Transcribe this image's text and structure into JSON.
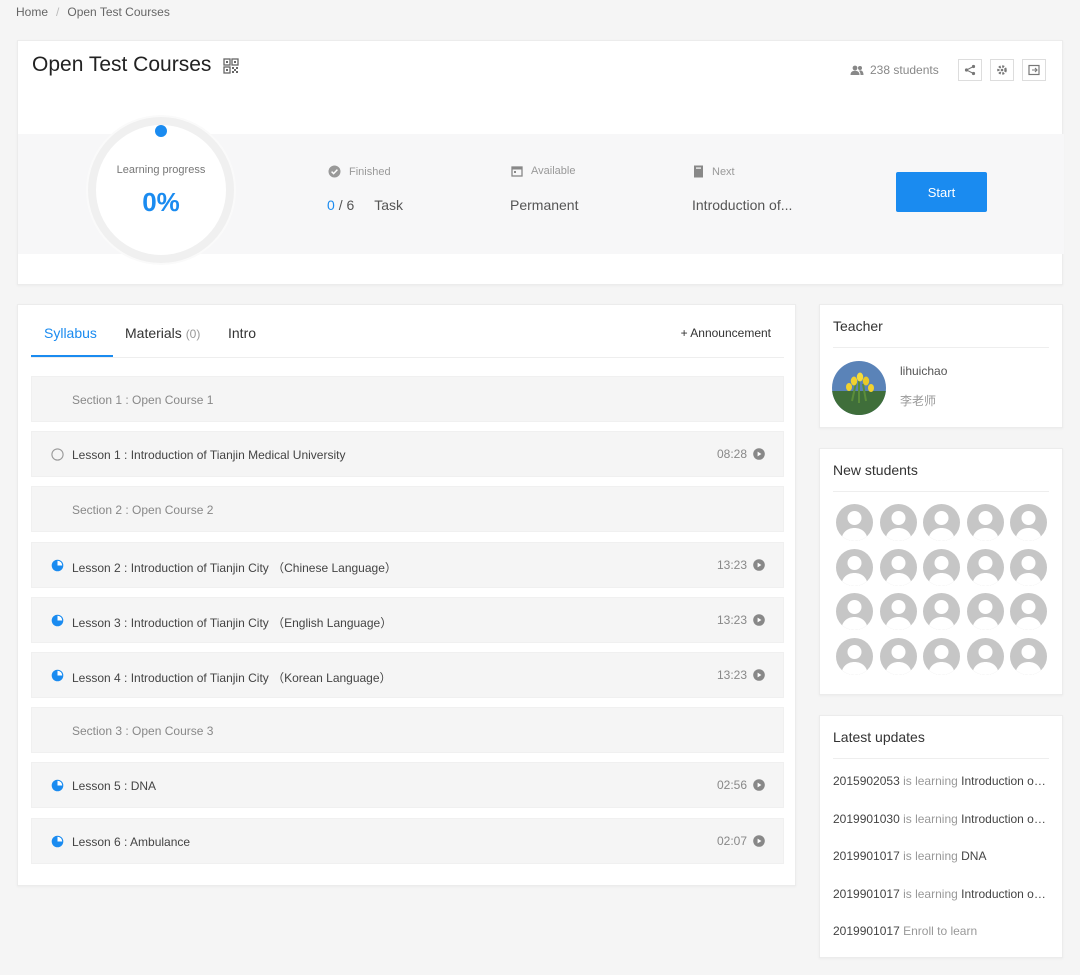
{
  "breadcrumb": {
    "home": "Home",
    "current": "Open Test Courses"
  },
  "header": {
    "title": "Open Test Courses",
    "students": "238 students"
  },
  "progress": {
    "label": "Learning progress",
    "value": "0%",
    "fraction": 0
  },
  "meta": {
    "finished_label": "Finished",
    "finished_done": "0",
    "finished_total": "/ 6",
    "finished_unit": "Task",
    "available_label": "Available",
    "available_value": "Permanent",
    "next_label": "Next",
    "next_value": "Introduction of..."
  },
  "start_button": "Start",
  "tabs": {
    "syllabus": "Syllabus",
    "materials": "Materials",
    "materials_count": "(0)",
    "intro": "Intro",
    "announcement": "+ Announcement"
  },
  "syllabus": [
    {
      "type": "section",
      "label": "Section 1 : Open Course 1"
    },
    {
      "type": "lesson",
      "label": "Lesson 1 : Introduction of Tianjin Medical University",
      "duration": "08:28",
      "status": "not-started"
    },
    {
      "type": "section",
      "label": "Section 2 : Open Course 2"
    },
    {
      "type": "lesson",
      "label": "Lesson 2 : Introduction of Tianjin City （Chinese Language）",
      "duration": "13:23",
      "status": "in-progress"
    },
    {
      "type": "lesson",
      "label": "Lesson 3 : Introduction of Tianjin City （English Language）",
      "duration": "13:23",
      "status": "in-progress"
    },
    {
      "type": "lesson",
      "label": "Lesson 4 : Introduction of Tianjin City （Korean Language）",
      "duration": "13:23",
      "status": "in-progress"
    },
    {
      "type": "section",
      "label": "Section 3 : Open Course 3"
    },
    {
      "type": "lesson",
      "label": "Lesson 5 : DNA",
      "duration": "02:56",
      "status": "in-progress"
    },
    {
      "type": "lesson",
      "label": "Lesson 6 : Ambulance",
      "duration": "02:07",
      "status": "in-progress"
    }
  ],
  "teacher": {
    "heading": "Teacher",
    "name": "lihuichao",
    "subtitle": "李老师"
  },
  "new_students": {
    "heading": "New students",
    "count": 20
  },
  "latest_updates": {
    "heading": "Latest updates",
    "items": [
      {
        "user": "2015902053",
        "action": "is learning",
        "target": "Introduction of Tianjin City"
      },
      {
        "user": "2019901030",
        "action": "is learning",
        "target": "Introduction of Tianjin City"
      },
      {
        "user": "2019901017",
        "action": "is learning",
        "target": "DNA"
      },
      {
        "user": "2019901017",
        "action": "is learning",
        "target": "Introduction of Tianjin City"
      },
      {
        "user": "2019901017",
        "action": "Enroll to learn",
        "target": ""
      }
    ]
  },
  "colors": {
    "accent": "#1a8bf0",
    "background": "#f5f5f5"
  }
}
